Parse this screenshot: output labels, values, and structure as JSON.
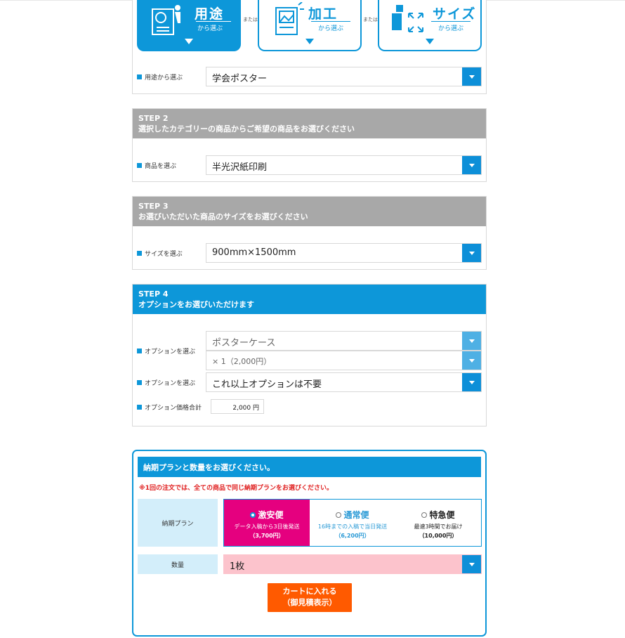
{
  "step1": {
    "cards": [
      {
        "title": "用途",
        "sub": "から選ぶ",
        "icon": "poster-icon",
        "active": true
      },
      {
        "title": "加工",
        "sub": "から選ぶ",
        "icon": "image-frame-icon",
        "active": false
      },
      {
        "title": "サイズ",
        "sub": "から選ぶ",
        "icon": "resize-icon",
        "active": false
      }
    ],
    "or_text": "または",
    "label": "用途から選ぶ",
    "value": "学会ポスター"
  },
  "step2": {
    "title": "STEP 2",
    "subtitle": "選択したカテゴリーの商品からご希望の商品をお選びください",
    "label": "商品を選ぶ",
    "value": "半光沢紙印刷"
  },
  "step3": {
    "title": "STEP 3",
    "subtitle": "お選びいただいた商品のサイズをお選びください",
    "label": "サイズを選ぶ",
    "value": "900mm×1500mm"
  },
  "step4": {
    "title": "STEP 4",
    "subtitle": "オプションをお選びいただけます",
    "option_label": "オプションを選ぶ",
    "option1": "ポスターケース",
    "option1_qty": "× 1（2,000円）",
    "option2": "これ以上オプションは不要",
    "total_label": "オプション価格合計",
    "total_value": "2,000 円"
  },
  "delivery": {
    "header": "納期プランと数量をお選びください。",
    "note": "※1回の注文では、全ての商品で同じ納期プランをお選びください。",
    "plan_label": "納期プラン",
    "plans": [
      {
        "name": "激安便",
        "desc": "データ入稿から3日後発送",
        "price": "（3,700円）",
        "selected": true
      },
      {
        "name": "通常便",
        "desc": "16時までの入稿で当日発送",
        "price": "（6,200円）",
        "selected": false
      },
      {
        "name": "特急便",
        "desc": "最速3時間でお届け",
        "price": "（10,000円）",
        "selected": false
      }
    ],
    "qty_label": "数量",
    "qty_value": "1枚",
    "cart_line1": "カートに入れる",
    "cart_line2": "（御見積表示）"
  },
  "colors": {
    "accent": "#0d97d9",
    "selected_plan": "#e5007f",
    "cart_button": "#ff5a00",
    "qty_bg": "#fcc3cc",
    "step_head_gray": "#a8a8a8"
  }
}
